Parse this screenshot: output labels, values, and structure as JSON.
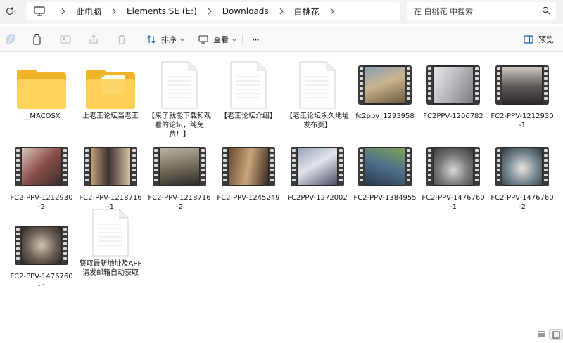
{
  "breadcrumb": [
    {
      "label": "此电脑"
    },
    {
      "label": "Elements SE (E:)"
    },
    {
      "label": "Downloads"
    },
    {
      "label": "白桃花"
    }
  ],
  "search": {
    "placeholder": "在 白桃花 中搜索"
  },
  "toolbar": {
    "sort_label": "排序",
    "view_label": "查看",
    "more_label": "···",
    "preview_label": "预览"
  },
  "items": [
    {
      "name": "__MACOSX",
      "type": "folder"
    },
    {
      "name": "上老王论坛当老王",
      "type": "folder"
    },
    {
      "name": "【来了就能下载和观看的论坛，纯免费！】",
      "type": "document"
    },
    {
      "name": "【老王论坛介绍】",
      "type": "document"
    },
    {
      "name": "【老王论坛永久地址发布页】",
      "type": "document"
    },
    {
      "name": "fc2ppv_1293958",
      "type": "video"
    },
    {
      "name": "FC2PPV-1206782",
      "type": "video"
    },
    {
      "name": "FC2-PPV-1212930-1",
      "type": "video"
    },
    {
      "name": "FC2-PPV-1212930-2",
      "type": "video"
    },
    {
      "name": "FC2-PPV-1218716-1",
      "type": "video"
    },
    {
      "name": "FC2-PPV-1218716-2",
      "type": "video"
    },
    {
      "name": "FC2-PPV-1245249",
      "type": "video"
    },
    {
      "name": "FC2PPV-1272002",
      "type": "video"
    },
    {
      "name": "FC2-PPV-1384955",
      "type": "video"
    },
    {
      "name": "FC2-PPV-1476760-1",
      "type": "video"
    },
    {
      "name": "FC2-PPV-1476760-2",
      "type": "video"
    },
    {
      "name": "FC2-PPV-1476760-3",
      "type": "video"
    },
    {
      "name": "获取最新地址及APP请发邮箱自动获取",
      "type": "document"
    }
  ]
}
